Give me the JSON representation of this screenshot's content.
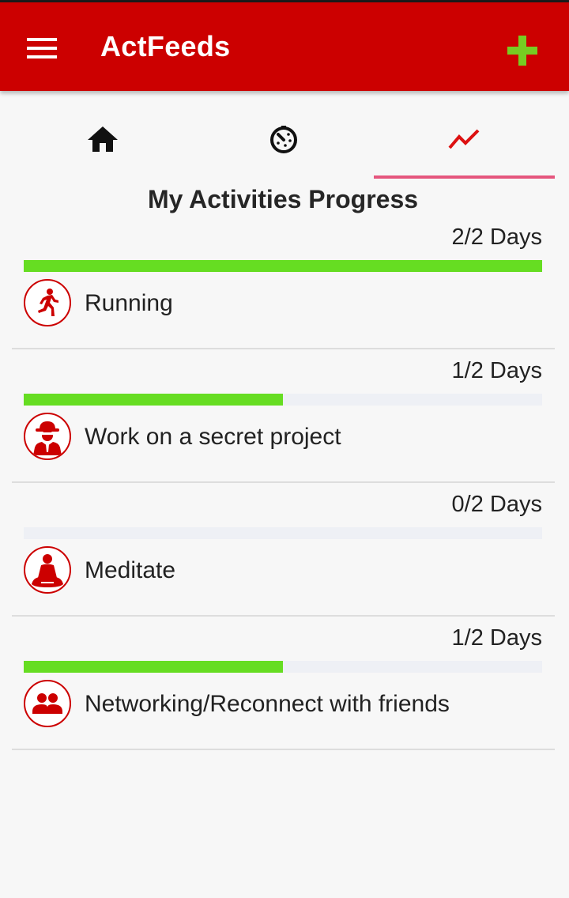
{
  "header": {
    "title": "ActFeeds",
    "menu_icon": "hamburger-menu-icon",
    "add_icon": "plus-icon",
    "colors": {
      "appbar": "#cc0000",
      "add_icon": "#77cc22"
    }
  },
  "tabs": [
    {
      "name": "home",
      "icon": "home-icon",
      "selected": false
    },
    {
      "name": "timer",
      "icon": "timer-icon",
      "selected": false
    },
    {
      "name": "progress",
      "icon": "trending-icon",
      "selected": true
    }
  ],
  "colors": {
    "indicator": "#e5567e",
    "progress_fill": "#66dd22",
    "progress_track": "#eef0f5",
    "icon_red": "#cc0000"
  },
  "page": {
    "title": "My Activities Progress"
  },
  "activities": [
    {
      "label": "Running",
      "days": "2/2 Days",
      "progress": 1.0,
      "icon": "running-icon"
    },
    {
      "label": "Work on a secret project",
      "days": "1/2 Days",
      "progress": 0.5,
      "icon": "spy-icon"
    },
    {
      "label": "Meditate",
      "days": "0/2 Days",
      "progress": 0.0,
      "icon": "meditate-icon"
    },
    {
      "label": "Networking/Reconnect with friends",
      "days": "1/2 Days",
      "progress": 0.5,
      "icon": "people-icon"
    }
  ]
}
